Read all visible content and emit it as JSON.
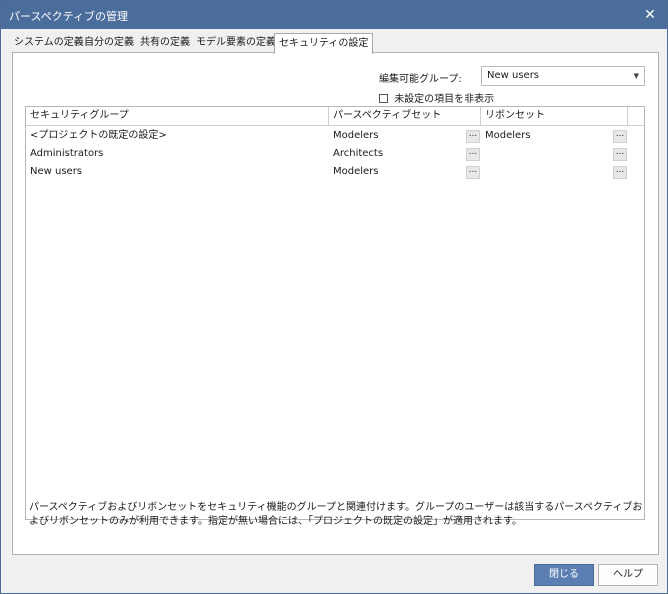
{
  "window": {
    "title": "パースペクティブの管理",
    "close_glyph": "✕"
  },
  "tabs": [
    {
      "label": "システムの定義"
    },
    {
      "label": "自分の定義"
    },
    {
      "label": "共有の定義"
    },
    {
      "label": "モデル要素の定義"
    },
    {
      "label": "セキュリティの設定"
    }
  ],
  "active_tab_index": 4,
  "editable_group": {
    "label": "編集可能グループ:",
    "value": "New users"
  },
  "hide_unset": {
    "label": "未設定の項目を非表示",
    "checked": false
  },
  "table": {
    "columns": [
      "セキュリティグループ",
      "パースペクティブセット",
      "リボンセット"
    ],
    "rows": [
      {
        "group": "<プロジェクトの既定の設定>",
        "perspective_set": "Modelers",
        "ribbon_set": "Modelers"
      },
      {
        "group": "Administrators",
        "perspective_set": "Architects",
        "ribbon_set": ""
      },
      {
        "group": "New users",
        "perspective_set": "Modelers",
        "ribbon_set": ""
      }
    ],
    "browse_label": "..."
  },
  "description": "パースペクティブおよびリボンセットをセキュリティ機能のグループと関連付けます。グループのユーザーは該当するパースペクティブおよびリボンセットのみが利用できます。指定が無い場合には、「プロジェクトの既定の設定」が適用されます。",
  "buttons": {
    "close": "閉じる",
    "help": "ヘルプ"
  },
  "colors": {
    "titlebar": "#4b6d9c",
    "primary_button": "#5b7fb3"
  }
}
